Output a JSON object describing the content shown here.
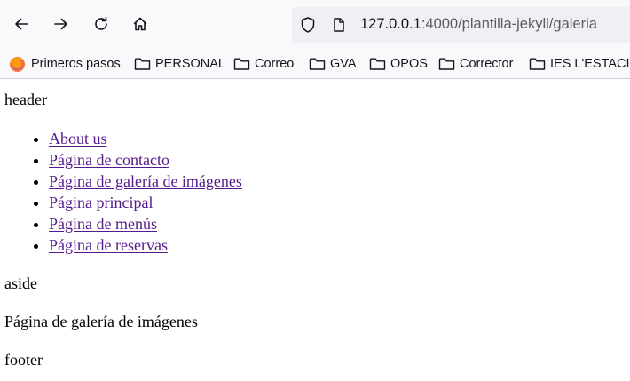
{
  "browser": {
    "url_host": "127.0.0.1",
    "url_rest": ":4000/plantilla-jekyll/galeria",
    "bookmarks": [
      {
        "label": "Primeros pasos",
        "icon": "firefox-icon"
      },
      {
        "label": "PERSONAL",
        "icon": "folder-icon"
      },
      {
        "label": "Correo",
        "icon": "folder-icon"
      },
      {
        "label": "GVA",
        "icon": "folder-icon"
      },
      {
        "label": "OPOS",
        "icon": "folder-icon"
      },
      {
        "label": "Corrector",
        "icon": "folder-icon"
      },
      {
        "label": "IES L'ESTACIÓ",
        "icon": "folder-icon"
      }
    ],
    "icons": {
      "back": "arrow-left-icon",
      "forward": "arrow-right-icon",
      "reload": "reload-icon",
      "home": "home-icon",
      "shield": "shield-icon",
      "page": "page-icon"
    }
  },
  "page": {
    "header": "header",
    "nav": [
      "About us",
      "Página de contacto",
      "Página de galería de imágenes",
      "Página principal",
      "Página de menús",
      "Página de reservas"
    ],
    "aside": "aside",
    "main": "Página de galería de imágenes",
    "footer": "footer"
  },
  "colors": {
    "link_visited": "#551a8b",
    "toolbar_bg": "#f9f9fb",
    "urlbar_bg": "#f0f0f4"
  }
}
